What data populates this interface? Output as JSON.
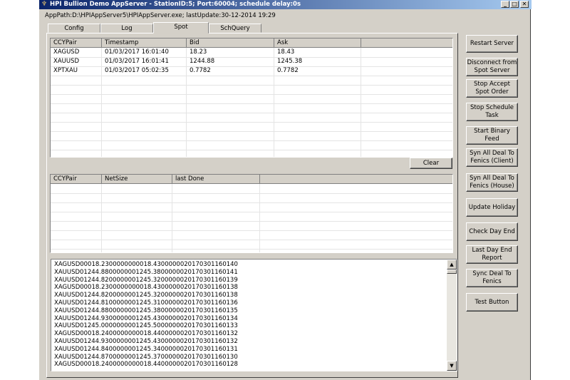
{
  "window": {
    "title": "HPI Bullion Demo AppServer - StationID:5; Port:60004; schedule delay:0s",
    "app_path": "AppPath:D:\\HPIAppServer5\\HPIAppServer.exe; lastUpdate:30-12-2014 19:29",
    "controls": {
      "minimize": "_",
      "maximize": "□",
      "close": "✕"
    },
    "icon": "window-app-icon"
  },
  "tabs": [
    "Config",
    "Log",
    "Spot",
    "SchQuery"
  ],
  "active_tab": "Spot",
  "spot_table": {
    "columns": [
      "CCYPair",
      "Timestamp",
      "Bid",
      "Ask"
    ],
    "rows": [
      [
        "XAGUSD",
        "01/03/2017 16:01:40",
        "18.23",
        "18.43"
      ],
      [
        "XAUUSD",
        "01/03/2017 16:01:41",
        "1244.88",
        "1245.38"
      ],
      [
        "XPTXAU",
        "01/03/2017 05:02:35",
        "0.7782",
        "0.7782"
      ]
    ]
  },
  "clear_label": "Clear",
  "position_table": {
    "columns": [
      "CCYPair",
      "NetSize",
      "last Done"
    ],
    "rows": []
  },
  "log_lines": [
    "XAGUSD00018.2300000000018.4300000020170301160140",
    "XAUUSD01244.8800000001245.3800000020170301160141",
    "XAUUSD01244.8200000001245.3200000020170301160139",
    "XAGUSD00018.2300000000018.4300000020170301160138",
    "XAUUSD01244.8200000001245.3200000020170301160138",
    "XAUUSD01244.8100000001245.3100000020170301160136",
    "XAUUSD01244.8800000001245.3800000020170301160135",
    "XAUUSD01244.9300000001245.4300000020170301160134",
    "XAUUSD01245.0000000001245.5000000020170301160133",
    "XAGUSD00018.2400000000018.4400000020170301160132",
    "XAUUSD01244.9300000001245.4300000020170301160132",
    "XAUUSD01244.8400000001245.3400000020170301160131",
    "XAUUSD01244.8700000001245.3700000020170301160130",
    "XAGUSD00018.2400000000018.4400000020170301160128"
  ],
  "side_buttons": [
    [
      "Restart Server"
    ],
    [
      "Disconnect from",
      "Spot Server"
    ],
    [
      "Stop Accept",
      "Spot Order"
    ],
    [
      "Stop Schedule",
      "Task"
    ],
    [
      "Start Binary",
      "Feed"
    ],
    [
      "Syn All Deal To",
      "Fenics (Client)"
    ],
    [
      "Syn All Deal To",
      "Fenics (House)"
    ],
    [
      "Update Holiday"
    ],
    [
      "Check Day End"
    ],
    [
      "Last Day End",
      "Report"
    ],
    [
      "Sync Deal To",
      "Fenics"
    ],
    [
      "Test Button"
    ]
  ],
  "scrollbar": {
    "up": "▲",
    "down": "▼"
  }
}
